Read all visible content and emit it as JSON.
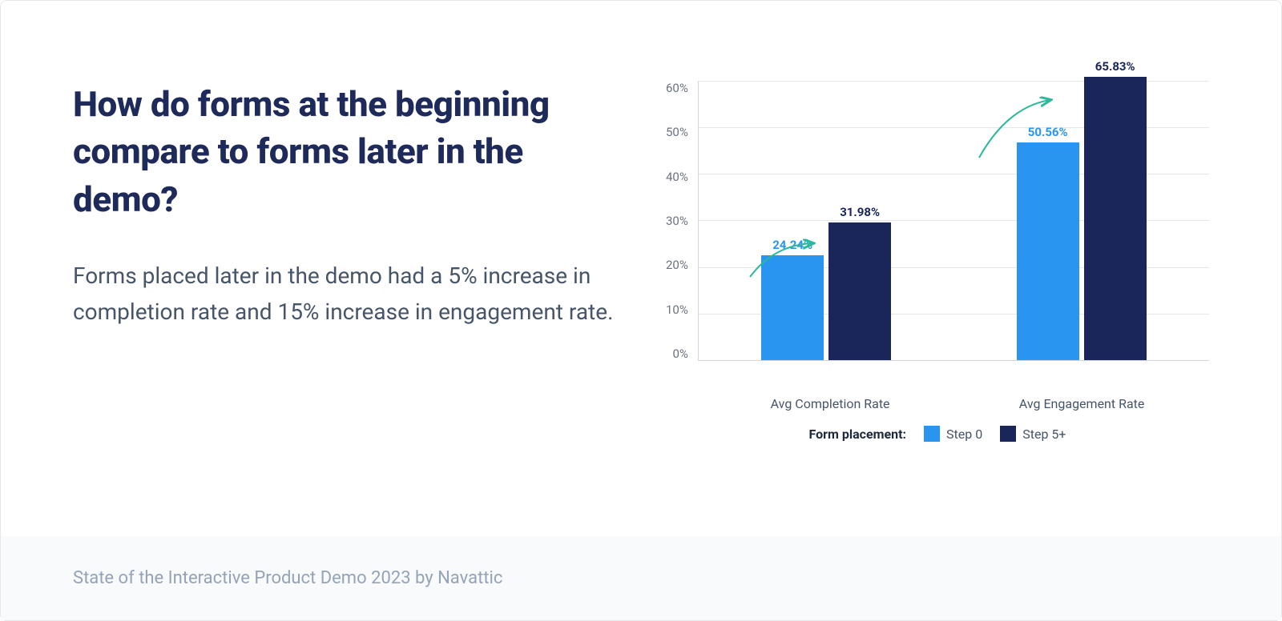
{
  "title": "How do forms at the beginning compare to forms later in the demo?",
  "body": "Forms placed later in the demo had a 5% increase in completion rate and 15% increase in engagement rate.",
  "footer": "State of the Interactive Product Demo 2023 by Navattic",
  "chart_data": {
    "type": "bar",
    "categories": [
      "Avg Completion Rate",
      "Avg Engagement Rate"
    ],
    "series": [
      {
        "name": "Step 0",
        "values": [
          24.24,
          50.56
        ],
        "color": "#2a95f1"
      },
      {
        "name": "Step 5+",
        "values": [
          31.98,
          65.83
        ],
        "color": "#1a2559"
      }
    ],
    "legend_title": "Form placement:",
    "ylim": [
      0,
      65
    ],
    "yticks": [
      "0%",
      "10%",
      "20%",
      "30%",
      "40%",
      "50%",
      "60%"
    ],
    "value_labels": [
      [
        "24.24%",
        "31.98%"
      ],
      [
        "50.56%",
        "65.83%"
      ]
    ],
    "arrow_color": "#2bb89b"
  }
}
